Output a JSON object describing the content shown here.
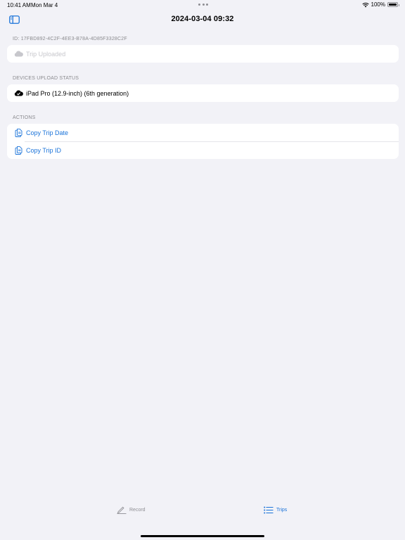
{
  "status_bar": {
    "time": "10:41 AM",
    "date": "Mon Mar 4",
    "battery": "100%",
    "battery_level": 1.0
  },
  "nav": {
    "title": "2024-03-04 09:32",
    "sidebar_icon": "sidebar-icon"
  },
  "trip": {
    "id_label": "ID: 17FBD892-4C2F-4EE3-B78A-4D85F3328C2F",
    "status": "Trip Uploaded",
    "status_icon": "cloud-icon"
  },
  "devices": {
    "header": "DEVICES UPLOAD STATUS",
    "items": [
      {
        "label": "iPad Pro (12.9-inch) (6th generation)",
        "icon": "cloud-check-icon"
      }
    ]
  },
  "actions": {
    "header": "ACTIONS",
    "items": [
      {
        "label": "Copy Trip Date",
        "icon": "copy-icon"
      },
      {
        "label": "Copy Trip ID",
        "icon": "copy-icon"
      }
    ]
  },
  "tabs": [
    {
      "label": "Record",
      "icon": "pencil-icon",
      "selected": false
    },
    {
      "label": "Trips",
      "icon": "list-icon",
      "selected": true
    }
  ],
  "colors": {
    "accent": "#1a73d9",
    "background": "#f2f2f7",
    "secondary_text": "#8a8a8e",
    "disabled_text": "#c7c7cc"
  }
}
